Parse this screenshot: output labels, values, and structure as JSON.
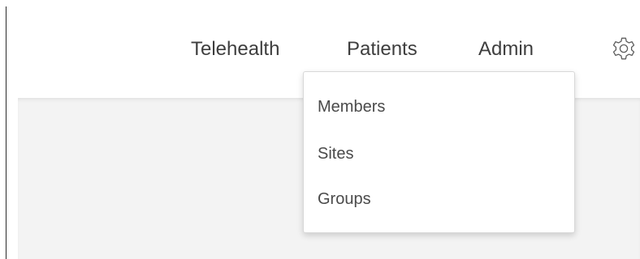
{
  "nav": {
    "items": [
      {
        "label": "Telehealth"
      },
      {
        "label": "Patients"
      },
      {
        "label": "Admin"
      }
    ],
    "settings_icon": "gear-icon"
  },
  "admin_menu": {
    "items": [
      {
        "label": "Members"
      },
      {
        "label": "Sites"
      },
      {
        "label": "Groups"
      }
    ]
  },
  "colors": {
    "nav_text": "#3e3e3e",
    "menu_text": "#4a4a4a",
    "content_background": "#f3f3f3",
    "menu_border": "#d8d8d8"
  }
}
